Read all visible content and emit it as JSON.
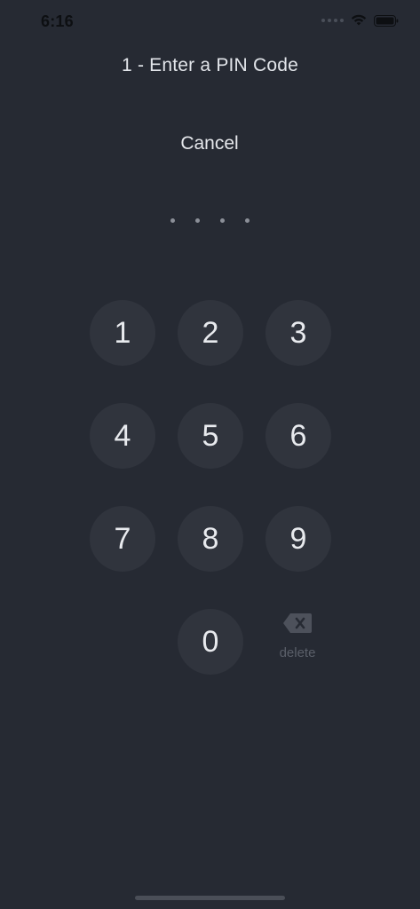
{
  "status_bar": {
    "time": "6:16"
  },
  "screen": {
    "title": "1 - Enter a PIN Code",
    "cancel_label": "Cancel",
    "pin_length": 4
  },
  "keypad": {
    "keys": [
      "1",
      "2",
      "3",
      "4",
      "5",
      "6",
      "7",
      "8",
      "9",
      "0"
    ],
    "delete_label": "delete",
    "delete_icon": "backspace-icon"
  }
}
